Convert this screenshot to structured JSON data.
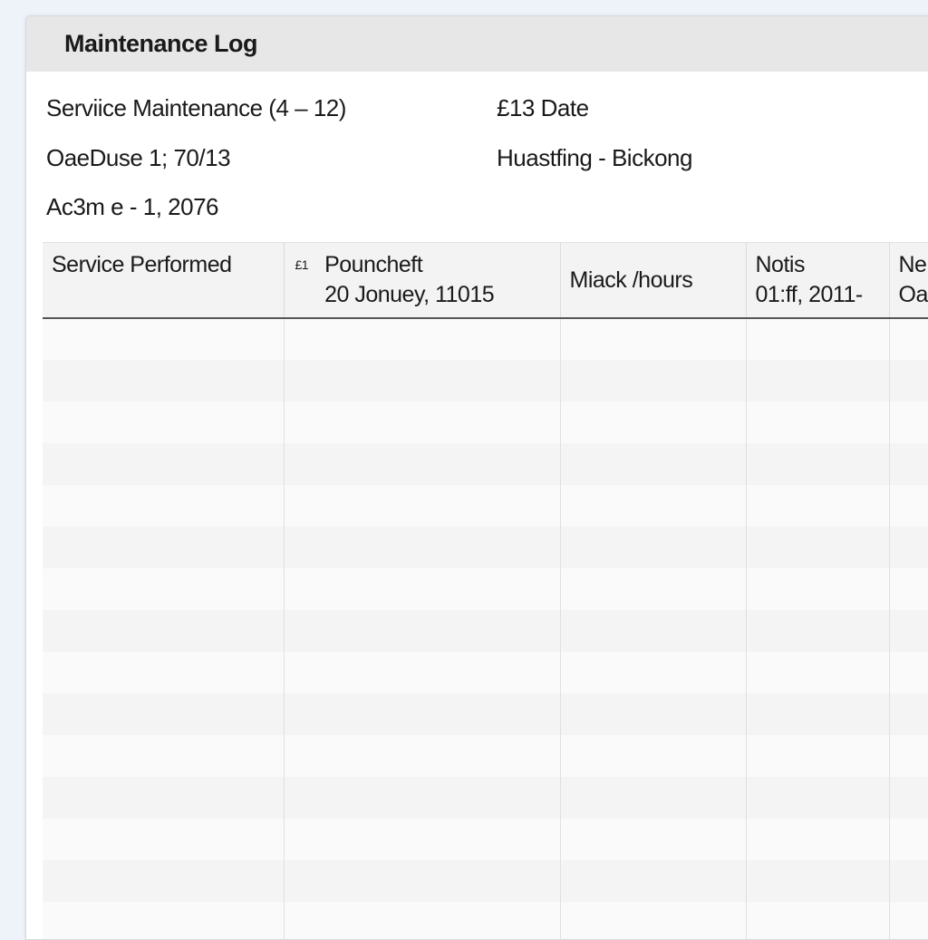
{
  "window": {
    "title": "Maintenance Log"
  },
  "info": {
    "service": "Serviice Maintenance (4 – 12)",
    "date_label": "£13 Date",
    "line2_left": "OaeDuse 1; 70/13",
    "line2_right": "Huastfing - Bickong",
    "line3_left": "Ac3m e - 1, 2076"
  },
  "table": {
    "columns": [
      {
        "label": "Service Performed",
        "sub": ""
      },
      {
        "icon": "£1",
        "label": "Pouncheft",
        "sub": "20 Jonuey, 11015"
      },
      {
        "label": "Miack /hours",
        "sub": ""
      },
      {
        "label": "Notis",
        "sub": "01:ff, 2011-"
      },
      {
        "label": "Ne",
        "sub": "Oa"
      }
    ],
    "rows": []
  }
}
